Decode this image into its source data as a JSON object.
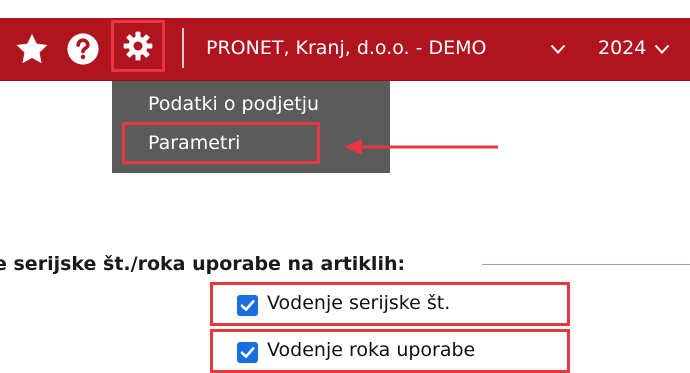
{
  "header": {
    "company": "PRONET, Kranj, d.o.o. - DEMO",
    "year": "2024",
    "icons": [
      "star-icon",
      "help-icon",
      "gear-icon",
      "chevron-down-icon"
    ],
    "colors": {
      "bar": "#b0151f",
      "highlight": "#e8383f"
    }
  },
  "settings_menu": {
    "items": [
      {
        "label": "Podatki o podjetju"
      },
      {
        "label": "Parametri"
      }
    ],
    "background": "#5b5b5b"
  },
  "section": {
    "title": "e serijske št./roka uporabe na artiklih:",
    "options": [
      {
        "label": "Vodenje serijske št.",
        "checked": true
      },
      {
        "label": "Vodenje roka uporabe",
        "checked": true
      }
    ],
    "checkbox_color": "#1a6fe0"
  }
}
